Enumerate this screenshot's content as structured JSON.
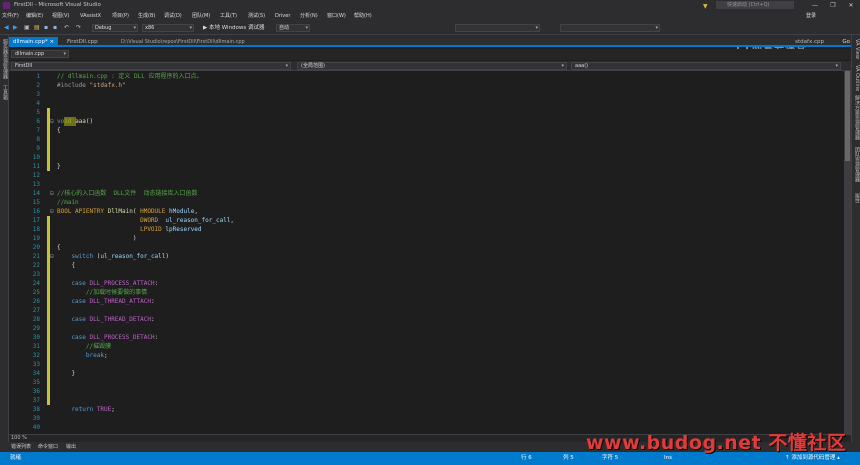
{
  "window": {
    "title": "FirstDll - Microsoft Visual Studio",
    "quick_launch": "快速启动 (Ctrl+Q)",
    "min": "—",
    "max": "❐",
    "close": "✕"
  },
  "menu": {
    "items": [
      "文件(F)",
      "编辑(E)",
      "视图(V)",
      "VAssistX",
      "项目(P)",
      "生成(B)",
      "调试(D)",
      "团队(M)",
      "工具(T)",
      "测试(S)",
      "Driver",
      "分析(N)",
      "窗口(W)",
      "帮助(H)"
    ],
    "signin": "登录"
  },
  "toolbar": {
    "config": "Debug",
    "platform": "x86",
    "run_label": "▶ 本地 Windows 调试器",
    "run_mode": "自动"
  },
  "watermark": {
    "text": "网易云课堂"
  },
  "left_panel": {
    "tabs": [
      "服务器资源管理器",
      "工具箱"
    ]
  },
  "right_panel": {
    "tabs": [
      "VA View",
      "VA Outline",
      "解决方案资源管理器",
      "团队资源管理器",
      "属性"
    ]
  },
  "doc_tabs": {
    "active": "dllmain.cpp*",
    "items": [
      "FirstDll.cpp"
    ],
    "path": "D:\\Visual Studio\\repos\\FirstDll\\FirstDll\\dllmain.cpp",
    "right_tab": "stdafx.cpp",
    "go": "Go"
  },
  "secondary": {
    "file": "dllmain.cpp"
  },
  "navbar": {
    "project": "FirstDll",
    "scope": "(全局范围)",
    "member": "aaa()"
  },
  "editor": {
    "line_numbers": [
      "1",
      "2",
      "3",
      "4",
      "5",
      "6",
      "7",
      "8",
      "9",
      "10",
      "11",
      "12",
      "13",
      "14",
      "15",
      "16",
      "17",
      "18",
      "19",
      "20",
      "21",
      "22",
      "23",
      "24",
      "25",
      "26",
      "27",
      "28",
      "29",
      "30",
      "31",
      "32",
      "33",
      "34",
      "35",
      "36",
      "37",
      "38",
      "39",
      "40"
    ],
    "lines": [
      [
        {
          "c": "c-com",
          "t": "// dllmain.cpp : 定义 DLL 应用程序的入口点。"
        }
      ],
      [
        {
          "c": "c-pre",
          "t": "#include "
        },
        {
          "c": "c-str",
          "t": "\"stdafx.h\""
        }
      ],
      [],
      [],
      [],
      [
        {
          "c": "c-kw",
          "t": "void "
        },
        {
          "c": "c-fn",
          "t": "aaa"
        },
        {
          "c": "c-txt",
          "t": "()"
        }
      ],
      [
        {
          "c": "c-txt",
          "t": "{"
        }
      ],
      [],
      [],
      [],
      [
        {
          "c": "c-txt",
          "t": "}"
        }
      ],
      [],
      [],
      [
        {
          "c": "c-com",
          "t": "//核心的入口函数  DLL文件  动态链接库入口函数"
        }
      ],
      [
        {
          "c": "c-com",
          "t": "//main"
        }
      ],
      [
        {
          "c": "c-ty",
          "t": "BOOL APIENTRY "
        },
        {
          "c": "c-fn",
          "t": "DllMain"
        },
        {
          "c": "c-txt",
          "t": "( "
        },
        {
          "c": "c-ty",
          "t": "HMODULE "
        },
        {
          "c": "c-par",
          "t": "hModule"
        },
        {
          "c": "c-txt",
          "t": ","
        }
      ],
      [
        {
          "c": "c-txt",
          "t": "                       "
        },
        {
          "c": "c-ty",
          "t": "DWORD  "
        },
        {
          "c": "c-par",
          "t": "ul_reason_for_call"
        },
        {
          "c": "c-txt",
          "t": ","
        }
      ],
      [
        {
          "c": "c-txt",
          "t": "                       "
        },
        {
          "c": "c-ty",
          "t": "LPVOID "
        },
        {
          "c": "c-par",
          "t": "lpReserved"
        }
      ],
      [
        {
          "c": "c-txt",
          "t": "                     )"
        }
      ],
      [
        {
          "c": "c-txt",
          "t": "{"
        }
      ],
      [
        {
          "c": "c-kw",
          "t": "    switch "
        },
        {
          "c": "c-txt",
          "t": "("
        },
        {
          "c": "c-par",
          "t": "ul_reason_for_call"
        },
        {
          "c": "c-txt",
          "t": ")"
        }
      ],
      [
        {
          "c": "c-txt",
          "t": "    {"
        }
      ],
      [],
      [
        {
          "c": "c-kw",
          "t": "    case "
        },
        {
          "c": "c-mac",
          "t": "DLL_PROCESS_ATTACH"
        },
        {
          "c": "c-txt",
          "t": ":"
        }
      ],
      [
        {
          "c": "c-com",
          "t": "        //加载时候要做的事情"
        }
      ],
      [
        {
          "c": "c-kw",
          "t": "    case "
        },
        {
          "c": "c-mac",
          "t": "DLL_THREAD_ATTACH"
        },
        {
          "c": "c-txt",
          "t": ":"
        }
      ],
      [],
      [
        {
          "c": "c-kw",
          "t": "    case "
        },
        {
          "c": "c-mac",
          "t": "DLL_THREAD_DETACH"
        },
        {
          "c": "c-txt",
          "t": ":"
        }
      ],
      [],
      [
        {
          "c": "c-kw",
          "t": "    case "
        },
        {
          "c": "c-mac",
          "t": "DLL_PROCESS_DETACH"
        },
        {
          "c": "c-txt",
          "t": ":"
        }
      ],
      [
        {
          "c": "c-com",
          "t": "        //摧毁膜"
        }
      ],
      [
        {
          "c": "c-kw",
          "t": "        break"
        },
        {
          "c": "c-txt",
          "t": ";"
        }
      ],
      [],
      [
        {
          "c": "c-txt",
          "t": "    }"
        }
      ],
      [],
      [],
      [],
      [
        {
          "c": "c-kw",
          "t": "    return "
        },
        {
          "c": "c-mac",
          "t": "TRUE"
        },
        {
          "c": "c-txt",
          "t": ";"
        }
      ],
      [],
      []
    ]
  },
  "zoom": "100 %",
  "output_tabs": [
    "错误列表",
    "命令窗口",
    "输出"
  ],
  "status": {
    "ready": "就绪",
    "row": "行 6",
    "col": "列 5",
    "char": "字符 5",
    "ins": "Ins",
    "source_control": "↑ 添加到源代码管理 ▴"
  },
  "site_watermark": "www.budog.net 不懂社区"
}
